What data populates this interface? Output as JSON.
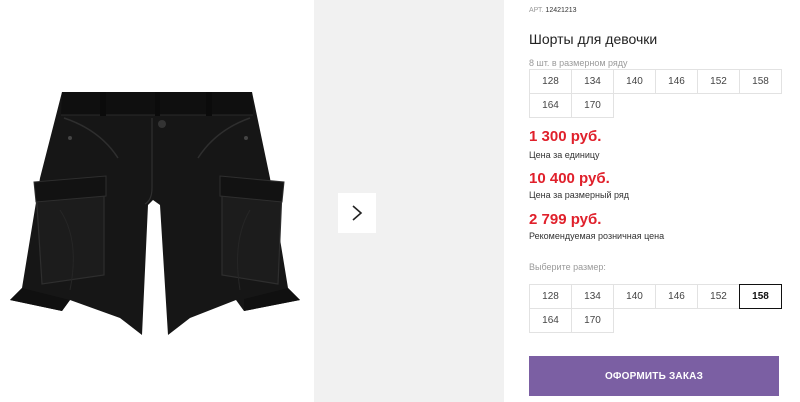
{
  "colors": {
    "accent": "#7b5fa3",
    "price": "#e0202b",
    "panel": "#f1f1f1"
  },
  "gallery": {
    "photo_alt": "black cargo shorts",
    "next_icon": "chevron-right-icon"
  },
  "product": {
    "sku_label": "АРТ.",
    "sku_value": "12421213",
    "title": "Шорты для девочки",
    "row_note": "8 шт. в размерном ряду",
    "row_sizes": [
      "128",
      "134",
      "140",
      "146",
      "152",
      "158",
      "164",
      "170"
    ]
  },
  "prices": {
    "unit_value": "1 300 руб.",
    "unit_caption": "Цена за единицу",
    "row_value": "10 400 руб.",
    "row_caption": "Цена за размерный ряд",
    "retail_value": "2 799 руб.",
    "retail_caption": "Рекомендуемая розничная цена"
  },
  "size_picker": {
    "label": "Выберите размер:",
    "options": [
      "128",
      "134",
      "140",
      "146",
      "152",
      "158",
      "164",
      "170"
    ],
    "selected": "158"
  },
  "order": {
    "button_label": "ОФОРМИТЬ ЗАКАЗ"
  }
}
